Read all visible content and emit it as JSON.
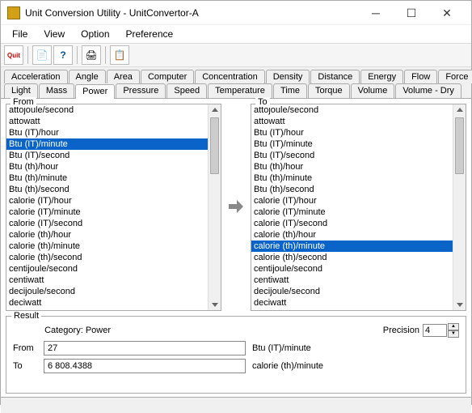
{
  "window": {
    "title": "Unit Conversion Utility - UnitConvertor-A"
  },
  "menu": {
    "file": "File",
    "view": "View",
    "option": "Option",
    "preference": "Preference"
  },
  "tabs_row1": [
    "Acceleration",
    "Angle",
    "Area",
    "Computer",
    "Concentration",
    "Density",
    "Distance",
    "Energy",
    "Flow",
    "Force"
  ],
  "tabs_row2": [
    "Light",
    "Mass",
    "Power",
    "Pressure",
    "Speed",
    "Temperature",
    "Time",
    "Torque",
    "Volume",
    "Volume - Dry"
  ],
  "active_tab": "Power",
  "from": {
    "label": "From",
    "selected": "Btu (IT)/minute",
    "items": [
      "attojoule/second",
      "attowatt",
      "Btu (IT)/hour",
      "Btu (IT)/minute",
      "Btu (IT)/second",
      "Btu (th)/hour",
      "Btu (th)/minute",
      "Btu (th)/second",
      "calorie (IT)/hour",
      "calorie (IT)/minute",
      "calorie (IT)/second",
      "calorie (th)/hour",
      "calorie (th)/minute",
      "calorie (th)/second",
      "centijoule/second",
      "centiwatt",
      "decijoule/second",
      "deciwatt"
    ]
  },
  "to": {
    "label": "To",
    "selected": "calorie (th)/minute",
    "items": [
      "attojoule/second",
      "attowatt",
      "Btu (IT)/hour",
      "Btu (IT)/minute",
      "Btu (IT)/second",
      "Btu (th)/hour",
      "Btu (th)/minute",
      "Btu (th)/second",
      "calorie (IT)/hour",
      "calorie (IT)/minute",
      "calorie (IT)/second",
      "calorie (th)/hour",
      "calorie (th)/minute",
      "calorie (th)/second",
      "centijoule/second",
      "centiwatt",
      "decijoule/second",
      "deciwatt"
    ]
  },
  "result": {
    "group_label": "Result",
    "category_label": "Category:",
    "category_value": "Power",
    "precision_label": "Precision",
    "precision_value": "4",
    "from_label": "From",
    "from_value": "27",
    "from_unit": "Btu (IT)/minute",
    "to_label": "To",
    "to_value": "6 808.4388",
    "to_unit": "calorie (th)/minute"
  },
  "toolbar_icons": {
    "quit": "Quit",
    "browse": "📄",
    "help": "?",
    "print": "🖨",
    "copy": "📋"
  }
}
